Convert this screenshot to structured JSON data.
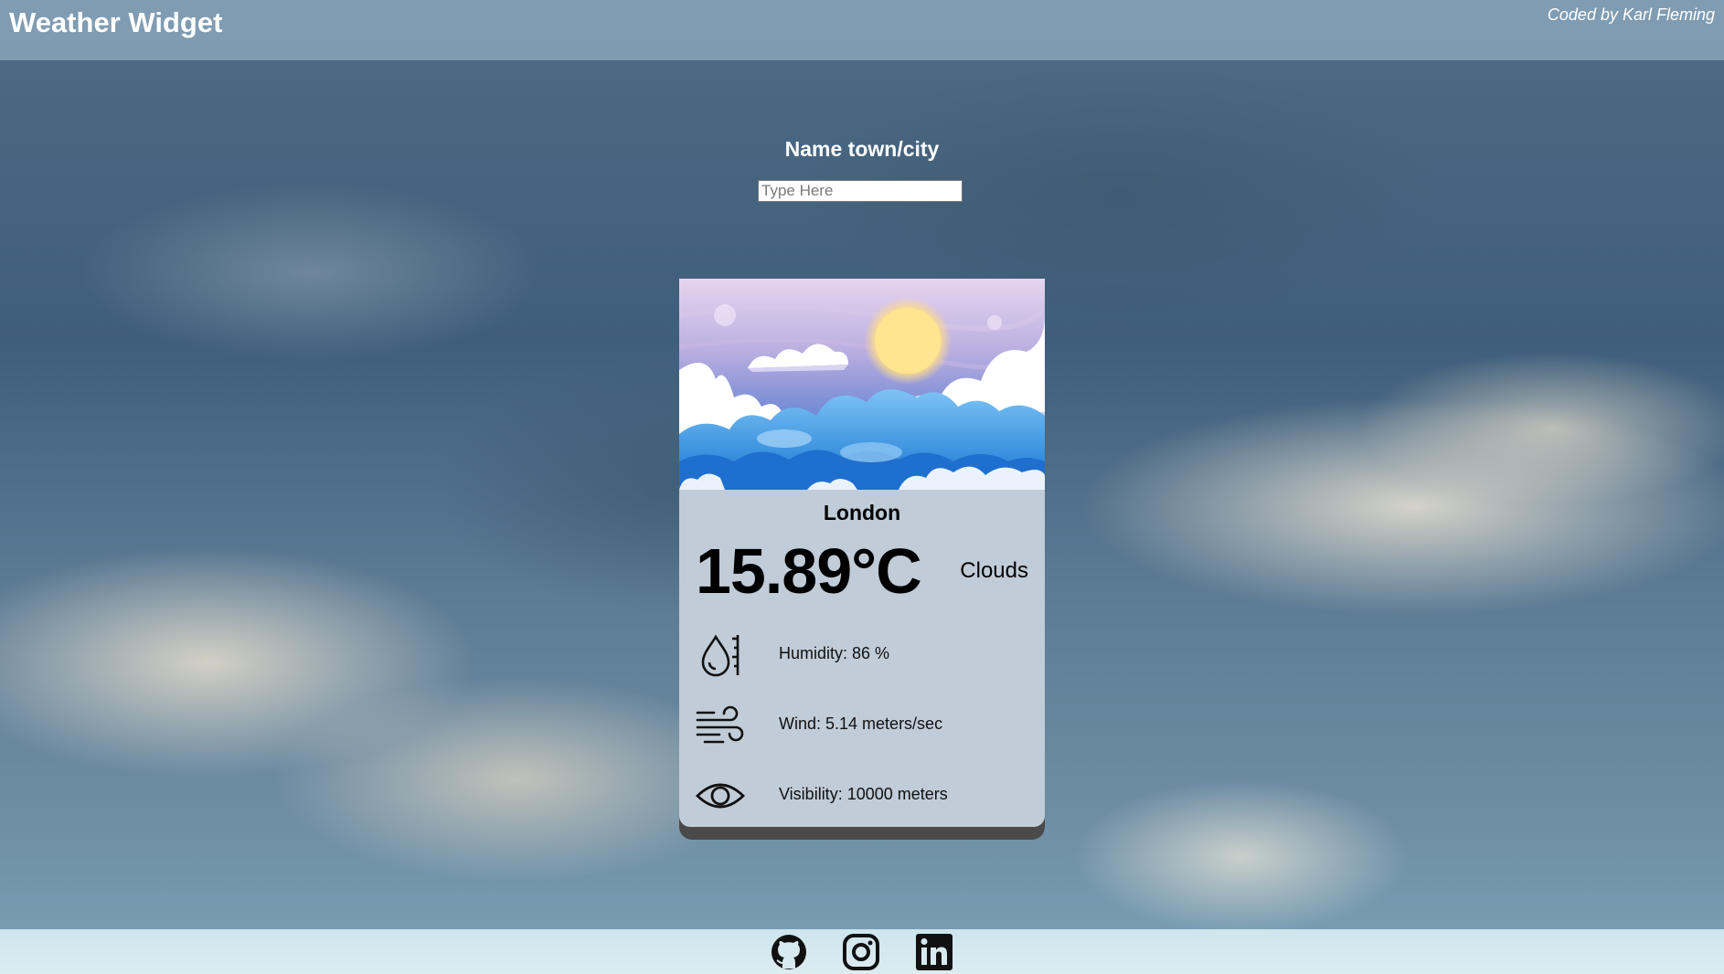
{
  "header": {
    "title": "Weather Widget",
    "credit": "Coded by Karl Fleming"
  },
  "search": {
    "label": "Name town/city",
    "placeholder": "Type Here",
    "value": ""
  },
  "weather": {
    "city": "London",
    "temperature": "15.89°C",
    "condition": "Clouds",
    "humidity": "Humidity: 86 %",
    "wind": "Wind: 5.14 meters/sec",
    "visibility": "Visibility: 10000 meters",
    "icons": {
      "humidity": "humidity-drop-icon",
      "wind": "wind-icon",
      "visibility": "eye-icon"
    }
  },
  "footer": {
    "links": [
      {
        "icon": "github-icon"
      },
      {
        "icon": "instagram-icon"
      },
      {
        "icon": "linkedin-icon"
      }
    ]
  },
  "colors": {
    "card_background": "#c0ccd8",
    "header_text": "#ffffff",
    "footer_background": "#d4e8ee"
  }
}
